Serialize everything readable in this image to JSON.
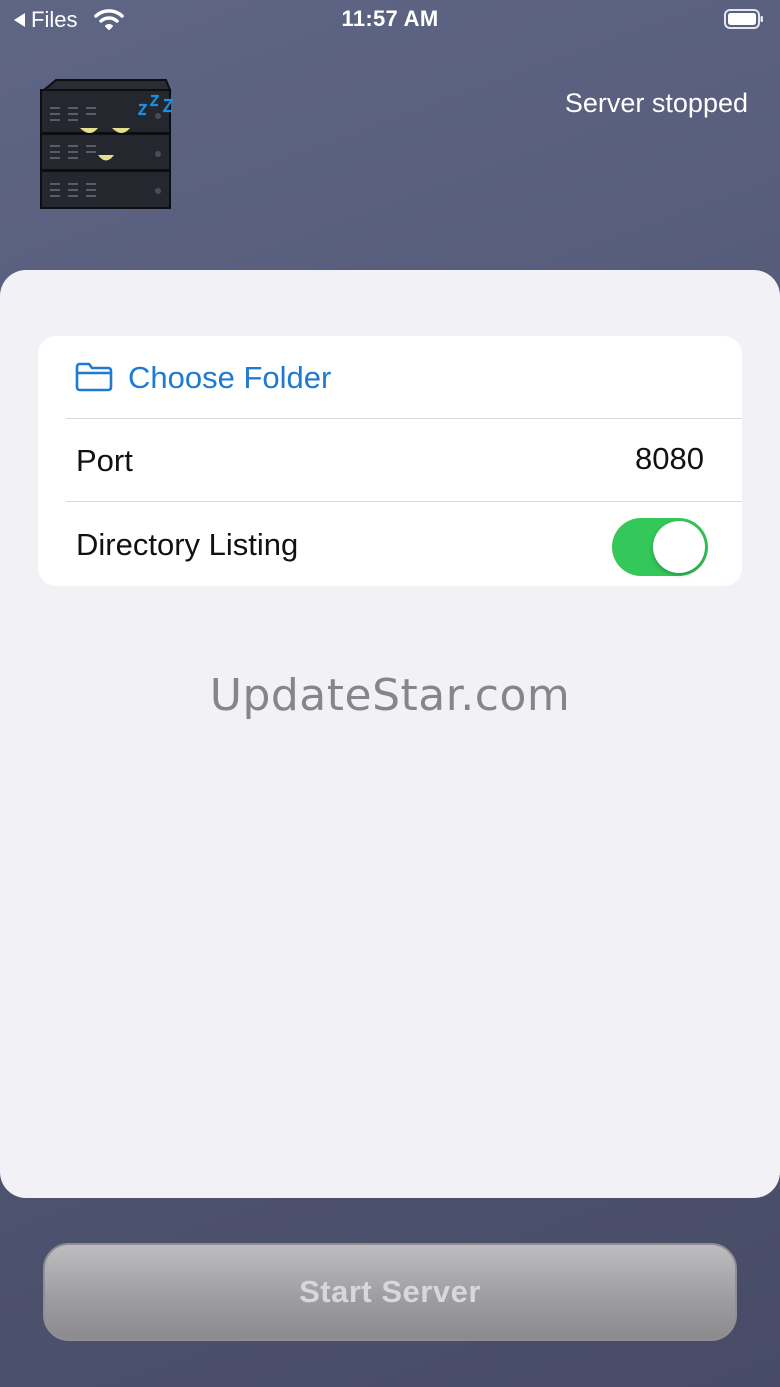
{
  "status_bar": {
    "back_label": "Files",
    "time": "11:57 AM",
    "icons": [
      "back-arrow-icon",
      "wifi-icon",
      "battery-icon"
    ]
  },
  "header": {
    "server_status": "Server stopped",
    "icon": "sleeping-server-icon",
    "sleep_text": "zzz"
  },
  "settings": {
    "choose_folder": {
      "label": "Choose Folder",
      "icon": "folder-icon"
    },
    "port": {
      "label": "Port",
      "value": "8080"
    },
    "directory_listing": {
      "label": "Directory Listing",
      "enabled": true
    }
  },
  "watermark": "UpdateStar.com",
  "start_button": {
    "label": "Start Server",
    "enabled": false
  },
  "colors": {
    "accent": "#1f7ad2",
    "toggle_on": "#34c759",
    "background_top": "#5f6584",
    "sheet": "#f1f1f6"
  }
}
